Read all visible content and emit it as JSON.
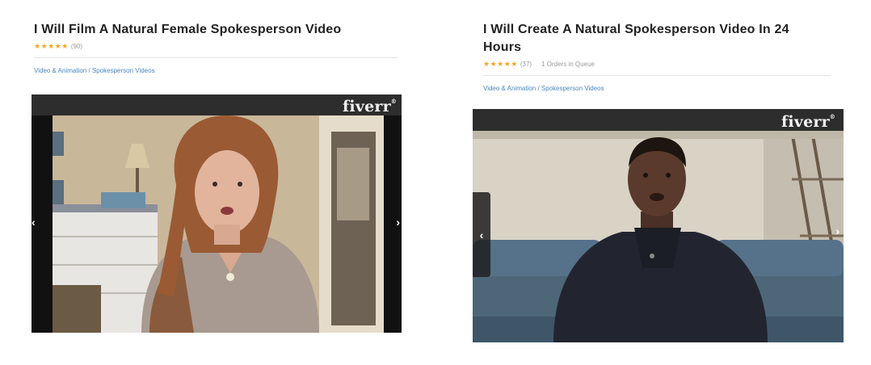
{
  "gigs": [
    {
      "title": "I Will Film A Natural Female Spokesperson Video",
      "stars": "★★★★★",
      "review_count": "(90)",
      "category": "Video & Animation / Spokesperson Videos",
      "logo": "fiverr",
      "prev_icon": "chevron-left-icon",
      "next_icon": "chevron-right-icon"
    },
    {
      "title": "I Will Create A Natural Spokesperson Video In 24 Hours",
      "stars": "★★★★★",
      "review_count": "(37)",
      "queue": "1 Orders in Queue",
      "category": "Video & Animation / Spokesperson Videos",
      "logo": "fiverr",
      "prev_icon": "chevron-left-icon",
      "next_icon": "chevron-right-icon"
    }
  ],
  "colors": {
    "star": "#f5a623",
    "category_link": "#4a86c0",
    "player_bar": "#2d2d2d"
  }
}
